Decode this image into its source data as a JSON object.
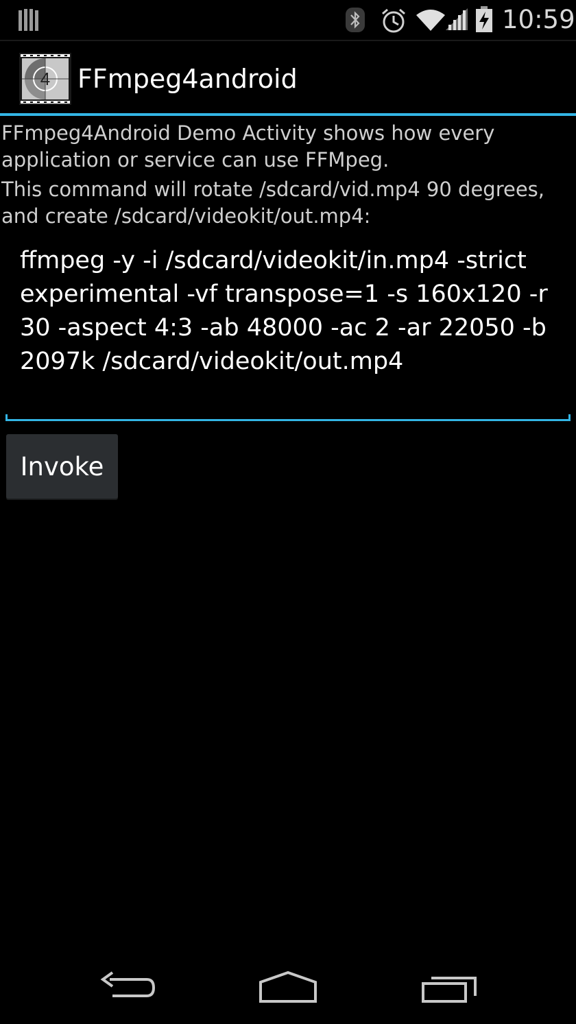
{
  "status_bar": {
    "time": "10:59",
    "icons": [
      "notification-bars-icon",
      "bluetooth-icon",
      "alarm-icon",
      "wifi-icon",
      "signal-icon",
      "battery-charging-icon"
    ]
  },
  "action_bar": {
    "title": "FFmpeg4android",
    "icon": "film-countdown-icon"
  },
  "content": {
    "description": "FFmpeg4Android Demo Activity shows how every application or service can use FFMpeg.",
    "command_info": "This command will rotate /sdcard/vid.mp4 90 degrees, and create /sdcard/videokit/out.mp4:",
    "command_value": "ffmpeg -y -i /sdcard/videokit/in.mp4 -strict experimental -vf transpose=1 -s 160x120 -r 30 -aspect 4:3 -ab 48000 -ac 2 -ar 22050 -b 2097k /sdcard/videokit/out.mp4",
    "invoke_label": "Invoke"
  },
  "nav_bar": {
    "icons": [
      "back-icon",
      "home-icon",
      "recent-apps-icon"
    ]
  },
  "colors": {
    "accent": "#33b5e5",
    "background": "#000000",
    "button": "#2b2e31"
  }
}
